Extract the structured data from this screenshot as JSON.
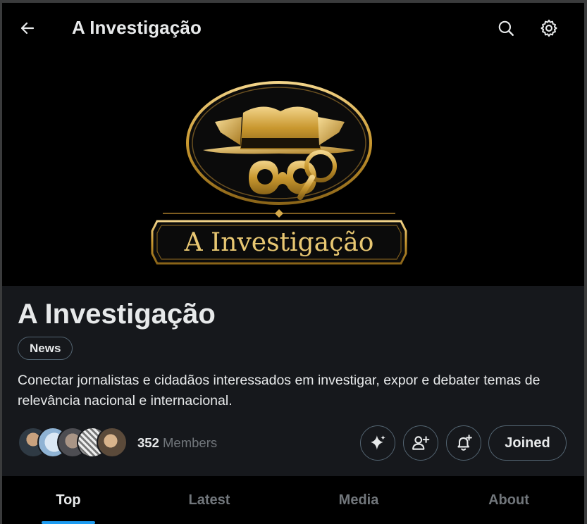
{
  "header": {
    "title": "A Investigação",
    "back_icon": "arrow-left-icon",
    "search_icon": "search-icon",
    "settings_icon": "gear-icon"
  },
  "banner": {
    "logo_text": "A Investigação"
  },
  "community": {
    "name": "A Investigação",
    "tag": "News",
    "description": "Conectar jornalistas e cidadãos interessados em investigar, expor e debater temas de relevância nacional e internacional.",
    "member_count": "352",
    "members_label": "Members",
    "joined_label": "Joined"
  },
  "tabs": [
    {
      "label": "Top",
      "active": true
    },
    {
      "label": "Latest",
      "active": false
    },
    {
      "label": "Media",
      "active": false
    },
    {
      "label": "About",
      "active": false
    }
  ],
  "colors": {
    "background": "#000000",
    "info_panel": "#16181c",
    "accent": "#1d9bf0",
    "gold": "#d4a94a",
    "muted_text": "#71767b"
  }
}
